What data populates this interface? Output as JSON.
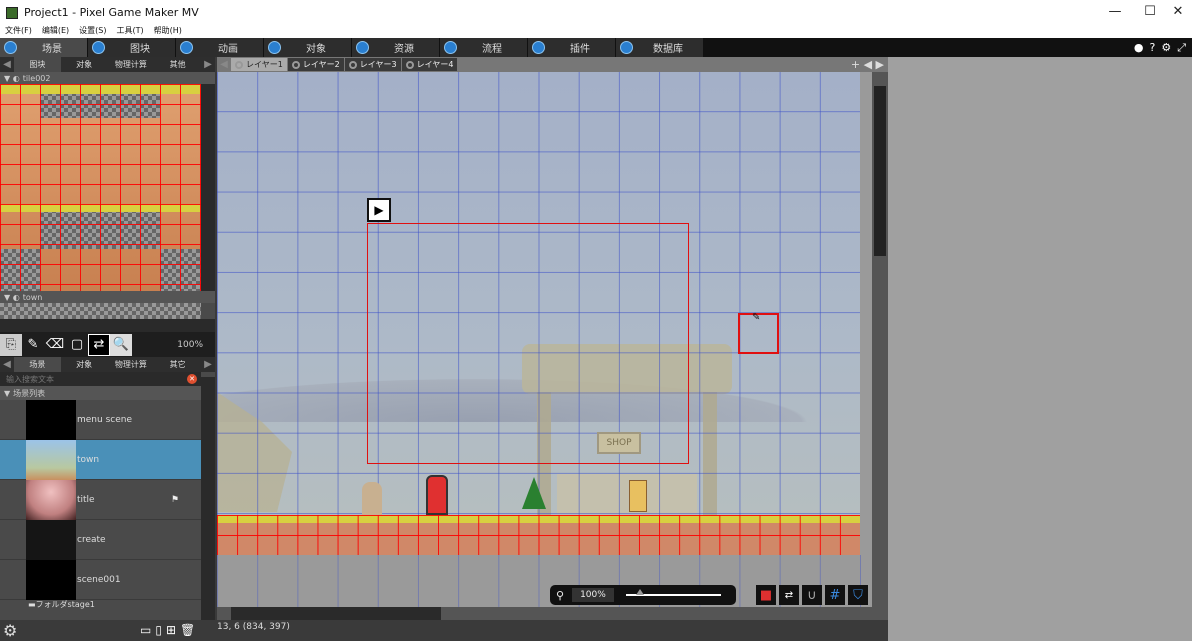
{
  "window": {
    "title": "Project1 - Pixel Game Maker MV",
    "minimize": "—",
    "maximize": "☐",
    "close": "✕"
  },
  "menu": [
    "文件(F)",
    "编辑(E)",
    "设置(S)",
    "工具(T)",
    "帮助(H)"
  ],
  "main_tabs": [
    "场景",
    "图块",
    "动画",
    "对象",
    "资源",
    "流程",
    "插件",
    "数据库"
  ],
  "top_left_tabs": [
    "图块",
    "对象",
    "物理计算",
    "其他"
  ],
  "layer_tabs": [
    "レイヤー1",
    "レイヤー2",
    "レイヤー3",
    "レイヤー4"
  ],
  "tileset": {
    "name1": "tile002",
    "name2": "town",
    "zoom": "100%"
  },
  "scene_tabs": [
    "场景",
    "对象",
    "物理计算",
    "其它"
  ],
  "search": {
    "placeholder": "输入搜索文本"
  },
  "scene_list": {
    "header": "场景列表",
    "items": [
      "menu scene",
      "town",
      "title",
      "create",
      "scene001"
    ],
    "folder": "フォルダstage1",
    "selected": "town"
  },
  "canvas": {
    "zoom": "100%",
    "shop_sign": "SHOP"
  },
  "status": {
    "coords": "13, 6 (834, 397)"
  },
  "colors": {
    "selected": "#4a90b8",
    "accent": "#2a7fd0",
    "selection_rect": "#e01010"
  }
}
